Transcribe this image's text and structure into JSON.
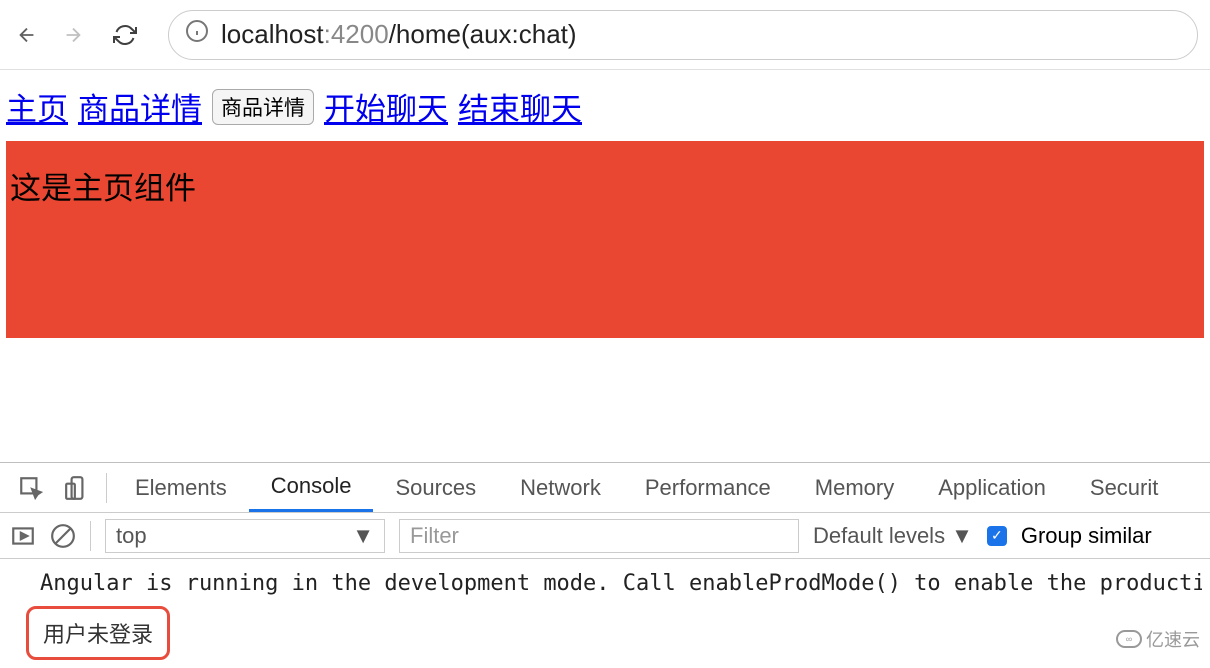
{
  "browser": {
    "url_host": "localhost",
    "url_port": ":4200",
    "url_path": "/home(aux:chat)"
  },
  "page": {
    "links": {
      "home": "主页",
      "product_detail": "商品详情",
      "product_detail_btn": "商品详情",
      "start_chat": "开始聊天",
      "end_chat": "结束聊天"
    },
    "panel_text": "这是主页组件"
  },
  "devtools": {
    "tabs": {
      "elements": "Elements",
      "console": "Console",
      "sources": "Sources",
      "network": "Network",
      "performance": "Performance",
      "memory": "Memory",
      "application": "Application",
      "security": "Securit"
    },
    "toolbar": {
      "context": "top",
      "filter_placeholder": "Filter",
      "levels": "Default levels",
      "group_similar": "Group similar"
    },
    "logs": {
      "angular_msg": "Angular is running in the development mode. Call enableProdMode() to enable the productio",
      "user_not_logged": "用户未登录"
    }
  },
  "watermark": "亿速云"
}
